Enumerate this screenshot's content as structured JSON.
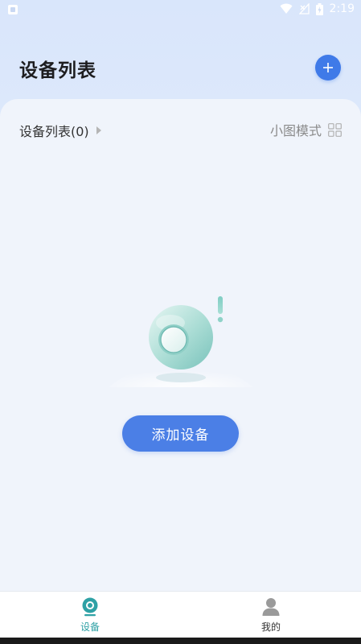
{
  "status_bar": {
    "time": "2:19",
    "icons": [
      "app-notification-icon",
      "wifi-icon",
      "signal-icon",
      "battery-icon"
    ]
  },
  "header": {
    "title": "设备列表",
    "add_icon": "plus-icon",
    "accent": "#3f7ae8"
  },
  "device_list": {
    "title": "设备列表(0)",
    "expand_icon": "triangle-right-icon",
    "view_mode_label": "小图模式",
    "view_mode_icon": "grid-icon"
  },
  "empty_state": {
    "illustration": "camera-alert-icon",
    "add_button_label": "添加设备",
    "button_color": "#4b7fe6"
  },
  "bottom_nav": {
    "items": [
      {
        "label": "设备",
        "icon": "camera-icon",
        "active": true
      },
      {
        "label": "我的",
        "icon": "user-icon",
        "active": false
      }
    ],
    "active_color": "#2ea1a5"
  }
}
